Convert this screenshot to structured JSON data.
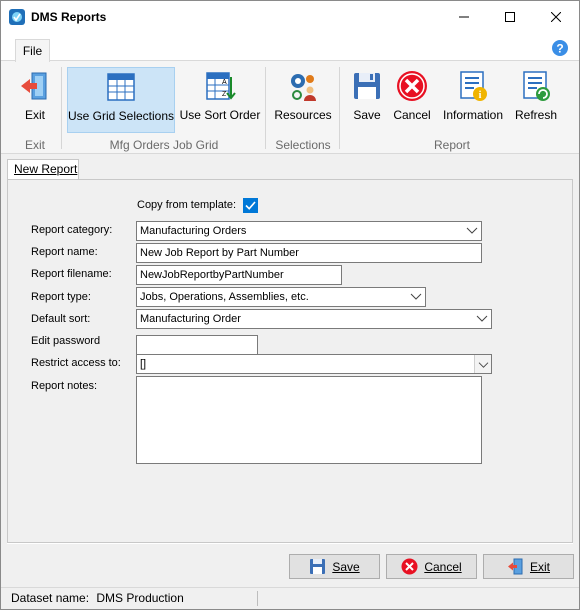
{
  "window": {
    "title": "DMS Reports"
  },
  "ribbon": {
    "tabs": [
      {
        "label": "File"
      }
    ],
    "buttons": {
      "exit": "Exit",
      "use_grid_selections": "Use Grid Selections",
      "use_sort_order": "Use Sort Order",
      "resources": "Resources",
      "save": "Save",
      "cancel": "Cancel",
      "information": "Information",
      "refresh": "Refresh"
    },
    "groups": {
      "exit": "Exit",
      "mfg": "Mfg Orders Job Grid",
      "selections": "Selections",
      "report": "Report"
    }
  },
  "page_tab": {
    "label": "New Report"
  },
  "form": {
    "copy_from_template": {
      "label": "Copy from template:",
      "checked": true
    },
    "report_category": {
      "label": "Report category:",
      "value": "Manufacturing Orders"
    },
    "report_name": {
      "label": "Report name:",
      "value": "New Job Report by Part Number"
    },
    "report_filename": {
      "label": "Report filename:",
      "value": "NewJobReportbyPartNumber"
    },
    "report_type": {
      "label": "Report type:",
      "value": "Jobs, Operations, Assemblies, etc."
    },
    "default_sort": {
      "label": "Default sort:",
      "value": "Manufacturing Order"
    },
    "edit_password": {
      "label": "Edit password",
      "value": ""
    },
    "restrict_access": {
      "label": "Restrict access to:",
      "value": "[]"
    },
    "report_notes": {
      "label": "Report notes:",
      "value": ""
    }
  },
  "dialog_buttons": {
    "save": "Save",
    "cancel": "Cancel",
    "exit": "Exit"
  },
  "status": {
    "dataset_label": "Dataset name:",
    "dataset_value": "DMS Production"
  },
  "colors": {
    "accent": "#0078d7",
    "selected_ribbon": "#cce4f7",
    "cancel_red": "#e81123"
  }
}
